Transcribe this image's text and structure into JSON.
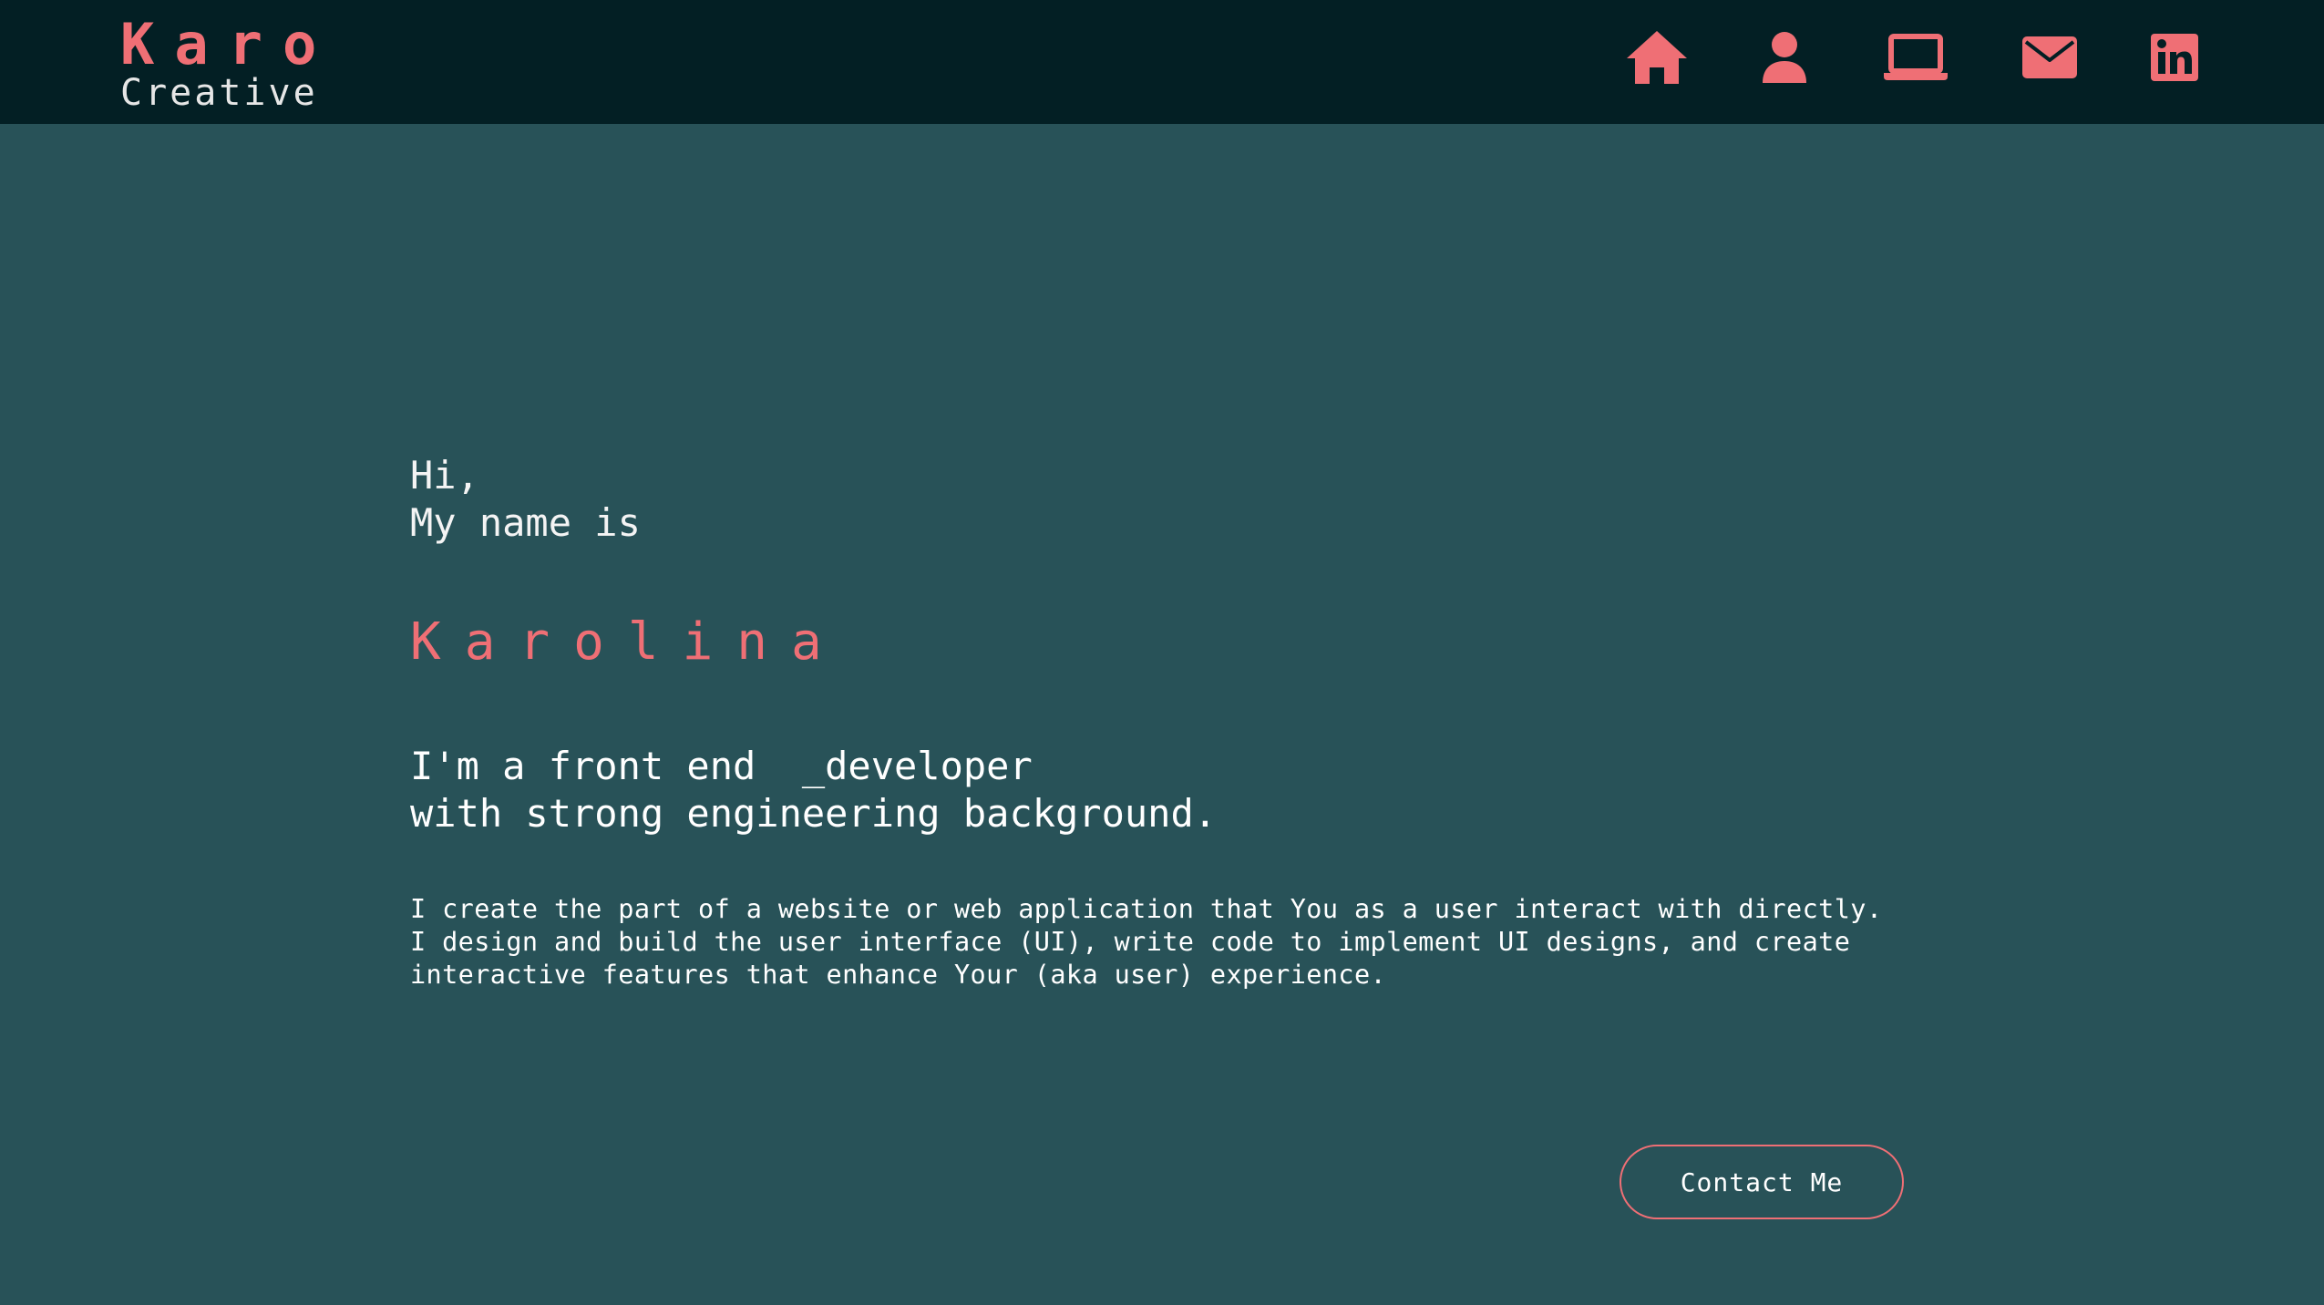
{
  "brand": {
    "name": "Karo",
    "tagline": "Creative"
  },
  "nav": {
    "items": [
      {
        "icon": "home-icon"
      },
      {
        "icon": "user-icon"
      },
      {
        "icon": "laptop-icon"
      },
      {
        "icon": "envelope-icon"
      },
      {
        "icon": "linkedin-icon"
      }
    ]
  },
  "hero": {
    "greeting_line1": "Hi,",
    "greeting_line2": "My name is",
    "name": "Karolina",
    "role_line1": "I'm a front end  _developer",
    "role_line2": "with strong engineering background.",
    "description": "I create the part of a website or web application that You as a user interact with directly. I design and build the user interface (UI), write code to implement UI designs, and create interactive features that enhance Your (aka user) experience.",
    "cta_label": "Contact Me"
  },
  "colors": {
    "navbar_bg": "#031f24",
    "page_bg": "#285258",
    "accent": "#ef6f75",
    "text": "#ffffff"
  }
}
